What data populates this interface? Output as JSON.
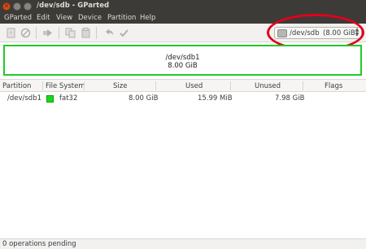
{
  "window": {
    "title": "/dev/sdb - GParted"
  },
  "menu": [
    "GParted",
    "Edit",
    "View",
    "Device",
    "Partition",
    "Help"
  ],
  "device_selector": {
    "name": "/dev/sdb",
    "size": "(8.00 GiB)"
  },
  "visual": {
    "partition": "/dev/sdb1",
    "size": "8.00 GiB",
    "fs_color": "#22c92a"
  },
  "table": {
    "headers": [
      "Partition",
      "File System",
      "Size",
      "Used",
      "Unused",
      "Flags"
    ],
    "rows": [
      {
        "partition": "/dev/sdb1",
        "filesystem": "fat32",
        "fs_color": "#18d918",
        "size": "8.00 GiB",
        "used": "15.99 MiB",
        "unused": "7.98 GiB",
        "flags": ""
      }
    ]
  },
  "status": {
    "text": "0 operations pending"
  }
}
